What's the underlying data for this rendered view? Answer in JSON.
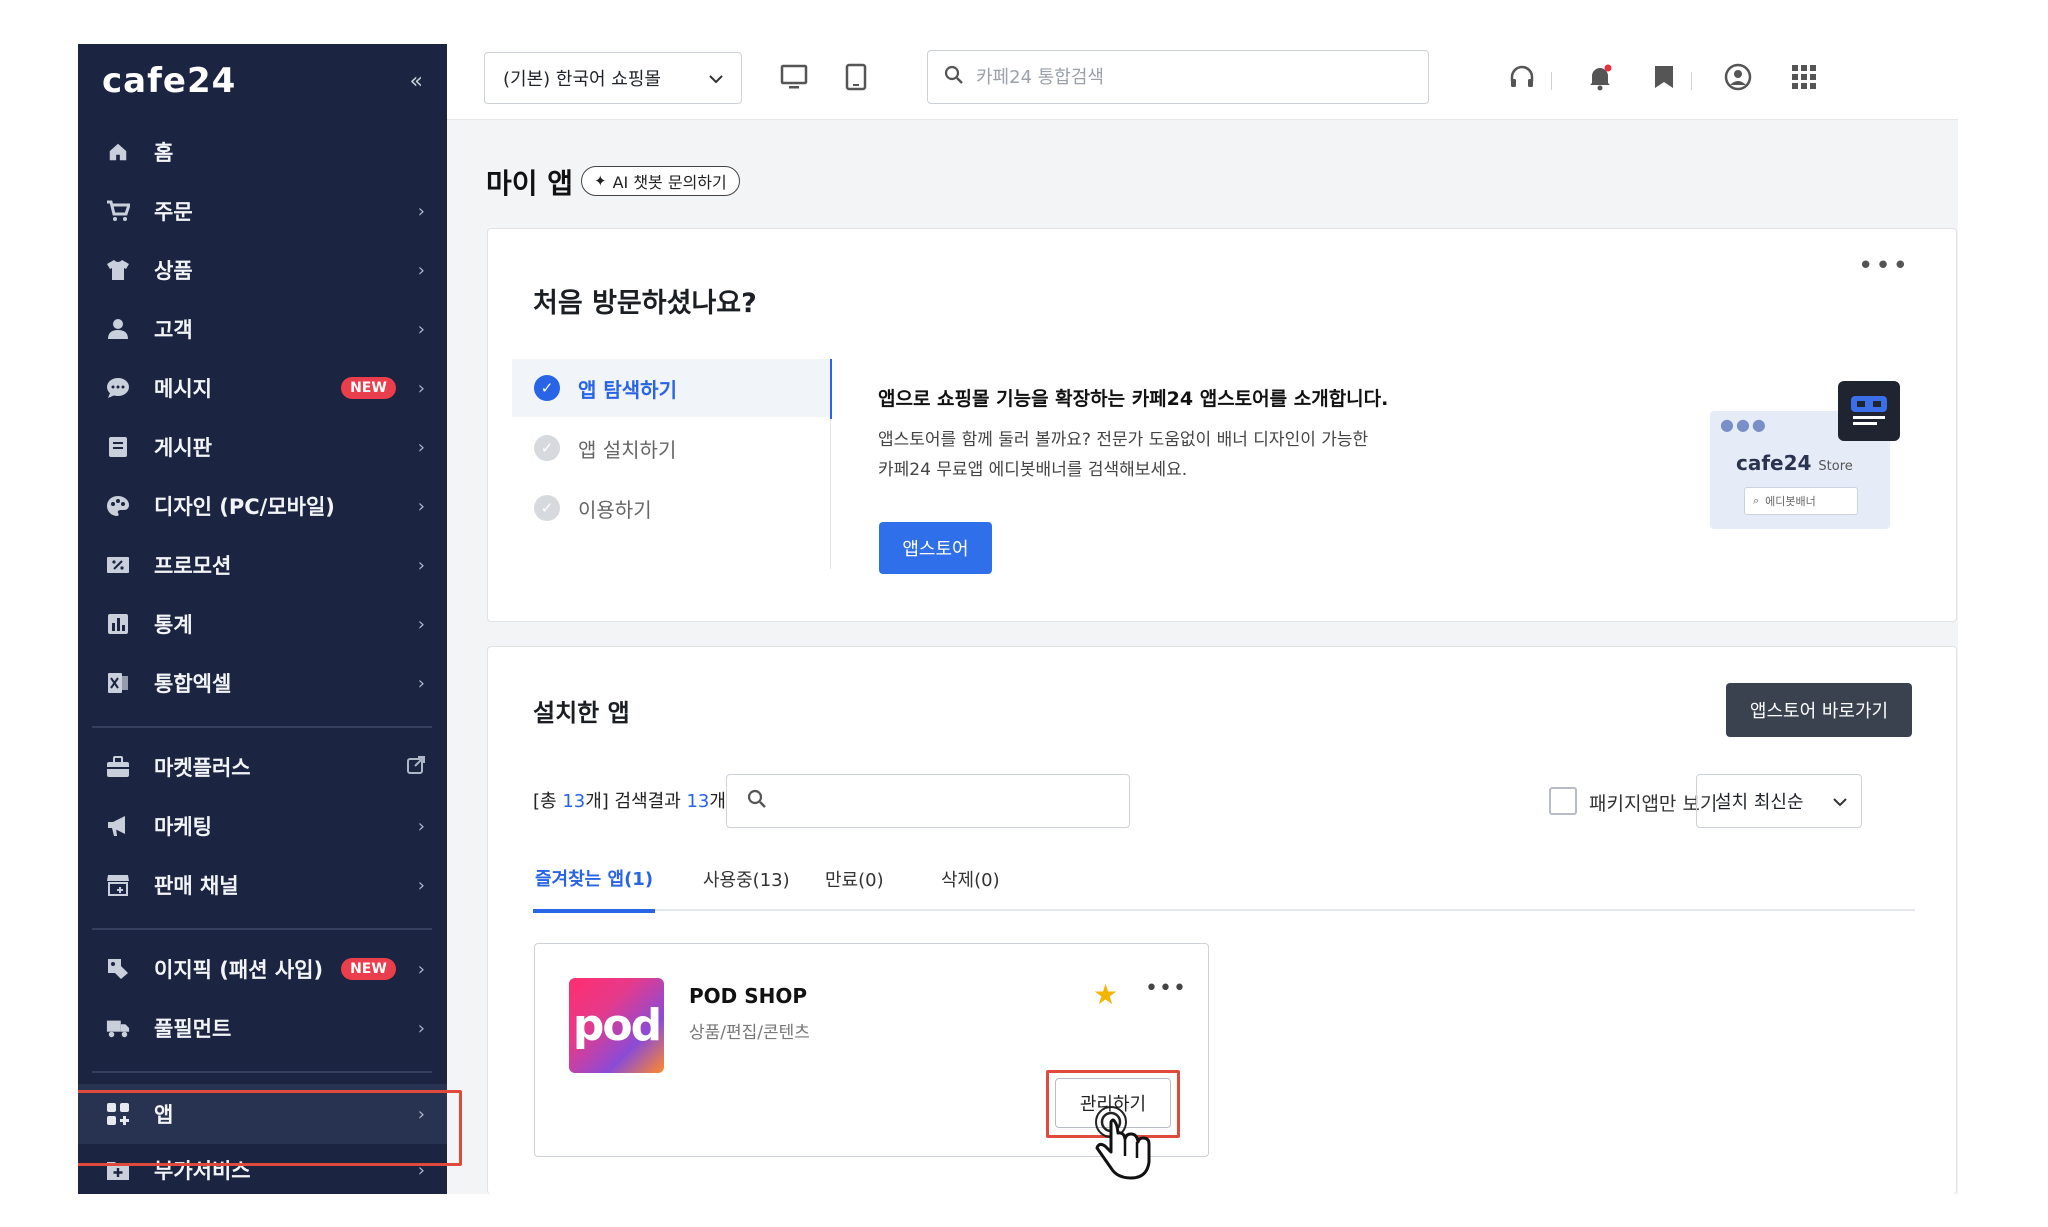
{
  "brand": {
    "logo": "cafe24",
    "accent": "#2864e6",
    "sidebar_bg": "#1b2541",
    "highlight": "#e04a3c"
  },
  "sidebar": {
    "collapse": "«",
    "items": [
      {
        "label": "홈",
        "icon": "home-icon"
      },
      {
        "label": "주문",
        "icon": "cart-icon"
      },
      {
        "label": "상품",
        "icon": "shirt-icon"
      },
      {
        "label": "고객",
        "icon": "user-icon"
      },
      {
        "label": "메시지",
        "icon": "chat-icon",
        "badge": "NEW"
      },
      {
        "label": "게시판",
        "icon": "board-icon"
      },
      {
        "label": "디자인 (PC/모바일)",
        "icon": "palette-icon"
      },
      {
        "label": "프로모션",
        "icon": "coupon-icon"
      },
      {
        "label": "통계",
        "icon": "chart-icon"
      },
      {
        "label": "통합엑셀",
        "icon": "excel-icon"
      },
      {
        "label": "마켓플러스",
        "icon": "market-icon"
      },
      {
        "label": "마케팅",
        "icon": "megaphone-icon"
      },
      {
        "label": "판매 채널",
        "icon": "store-icon"
      },
      {
        "label": "이지픽 (패션 사입)",
        "icon": "tag-icon",
        "badge": "NEW"
      },
      {
        "label": "풀필먼트",
        "icon": "truck-icon"
      },
      {
        "label": "앱",
        "icon": "apps-icon"
      },
      {
        "label": "부가서비스",
        "icon": "plus-box-icon"
      }
    ]
  },
  "topbar": {
    "mall_select": "(기본) 한국어 쇼핑몰",
    "search_placeholder": "카페24 통합검색"
  },
  "page": {
    "title": "마이 앱",
    "ai_chip": "AI 챗봇 문의하기"
  },
  "onboarding": {
    "title": "처음 방문하셨나요?",
    "steps": [
      "앱 탐색하기",
      "앱 설치하기",
      "이용하기"
    ],
    "headline": "앱으로 쇼핑몰 기능을 확장하는 카페24 앱스토어를 소개합니다.",
    "body_line1": "앱스토어를 함께 둘러 볼까요? 전문가 도움없이 배너 디자인이 가능한",
    "body_line2": "카페24 무료앱 에디봇배너를 검색해보세요.",
    "button": "앱스토어",
    "illus_logo": "cafe24",
    "illus_store": "Store",
    "illus_search": "에디봇배너"
  },
  "installed": {
    "title": "설치한 앱",
    "store_button": "앱스토어 바로가기",
    "count_prefix": "[총 ",
    "total": "13",
    "count_mid": "개] 검색결과 ",
    "results": "13",
    "count_suffix": "개",
    "package_only": "패키지앱만 보기",
    "sort": "설치 최신순",
    "tabs": [
      "즐겨찾는 앱(1)",
      "사용중(13)",
      "만료(0)",
      "삭제(0)"
    ],
    "apps": [
      {
        "logo_text": "pod",
        "name": "POD SHOP",
        "category": "상품/편집/콘텐츠",
        "manage": "관리하기"
      }
    ]
  }
}
